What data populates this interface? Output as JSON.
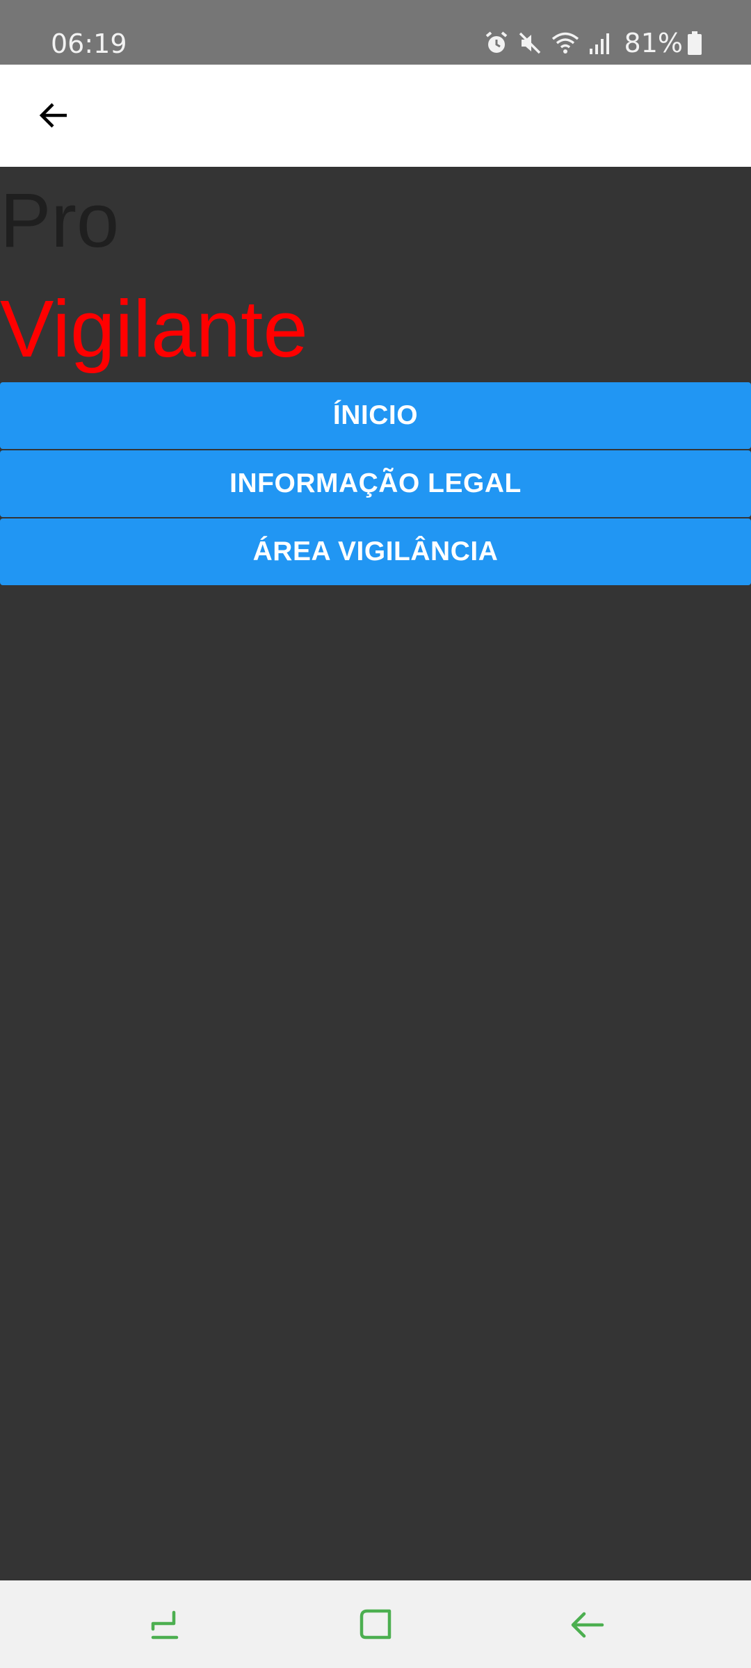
{
  "status_bar": {
    "time": "06:19",
    "battery": "81%",
    "icons": [
      "alarm-icon",
      "mute-icon",
      "wifi-icon",
      "signal-icon",
      "battery-icon"
    ]
  },
  "app_bar": {
    "back_icon": "arrow-left-icon"
  },
  "brand": {
    "line1": "Pro",
    "line2": "Vigilante",
    "line1_color": "#1f1f1f",
    "line2_color": "#ff0000"
  },
  "menu": {
    "items": [
      {
        "label": "ÍNICIO"
      },
      {
        "label": "INFORMAÇÃO LEGAL"
      },
      {
        "label": "ÁREA VIGILÂNCIA"
      }
    ],
    "button_color": "#2196f3"
  },
  "nav_bar": {
    "icons": [
      "recent-apps-icon",
      "home-icon",
      "back-icon"
    ],
    "icon_color": "#4caf50"
  }
}
